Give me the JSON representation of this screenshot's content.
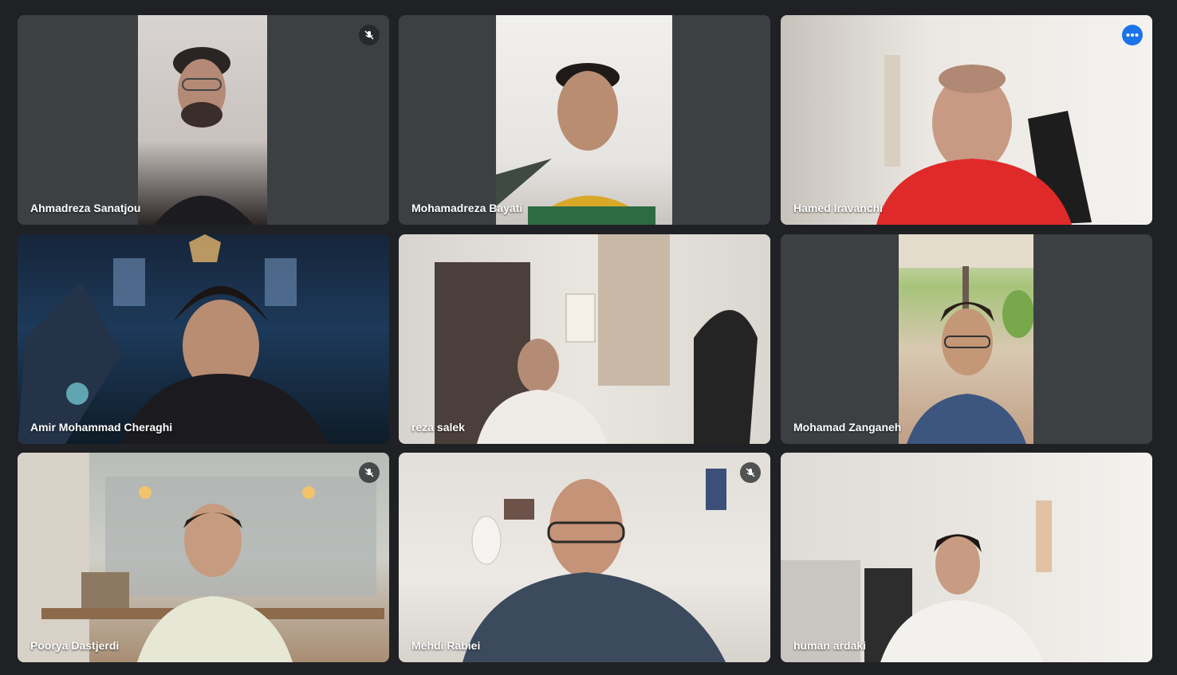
{
  "participants": [
    {
      "name": "Ahmadreza Sanatjou",
      "muted": true
    },
    {
      "name": "Mohamadreza Bayati",
      "muted": false
    },
    {
      "name": "Hamed Iravanchi",
      "muted": false,
      "active": true
    },
    {
      "name": "Amir Mohammad Cheraghi",
      "muted": false
    },
    {
      "name": "reza salek",
      "muted": false
    },
    {
      "name": "Mohamad Zanganeh",
      "muted": false
    },
    {
      "name": "Poorya Dastjerdi",
      "muted": true
    },
    {
      "name": "Mehdi Rabiei",
      "muted": true
    },
    {
      "name": "human ardaki",
      "muted": false
    }
  ],
  "icons": {
    "mute": "mic-off-icon",
    "more": "more-options-icon"
  },
  "colors": {
    "background": "#202124",
    "tile": "#3c4043",
    "active_border": "#8ab4f8",
    "more_button": "#1a73e8"
  }
}
